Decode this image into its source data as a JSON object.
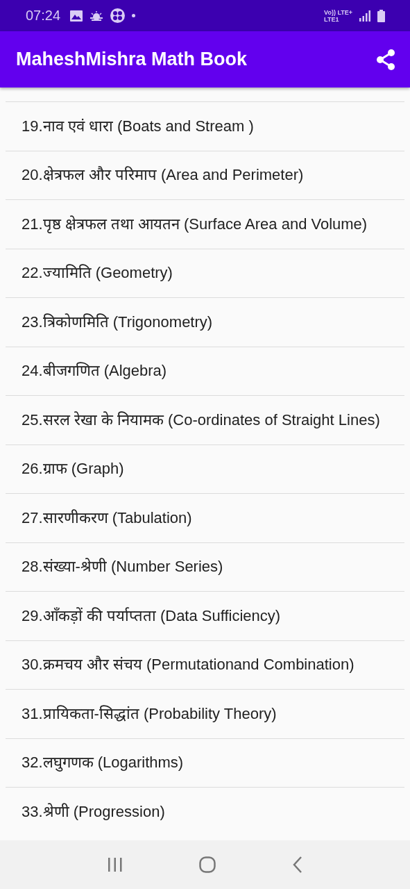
{
  "status_bar": {
    "time": "07:24",
    "network_top": "Vo)) LTE+",
    "network_bottom": "LTE1"
  },
  "app_bar": {
    "title": "MaheshMishra Math Book"
  },
  "chapters": [
    {
      "label": "19.नाव एवं धारा (Boats and Stream )"
    },
    {
      "label": "20.क्षेत्रफल और परिमाप (Area and Perimeter)"
    },
    {
      "label": "21.पृष्ठ क्षेत्रफल तथा आयतन (Surface Area and Volume)"
    },
    {
      "label": "22.ज्यामिति (Geometry)"
    },
    {
      "label": "23.त्रिकोणमिति (Trigonometry)"
    },
    {
      "label": "24.बीजगणित (Algebra)"
    },
    {
      "label": "25.सरल रेखा के नियामक (Co-ordinates of Straight Lines)"
    },
    {
      "label": "26.ग्राफ (Graph)"
    },
    {
      "label": "27.सारणीकरण (Tabulation)"
    },
    {
      "label": "28.संख्या-श्रेणी (Number Series)"
    },
    {
      "label": "29.आँकड़ों की पर्याप्तता (Data Sufficiency)"
    },
    {
      "label": "30.क्रमचय और संचय (Permutationand Combination)"
    },
    {
      "label": "31.प्रायिकता-सिद्धांत (Probability Theory)"
    },
    {
      "label": "32.लघुगणक (Logarithms)"
    },
    {
      "label": "33.श्रेणी (Progression)"
    }
  ]
}
